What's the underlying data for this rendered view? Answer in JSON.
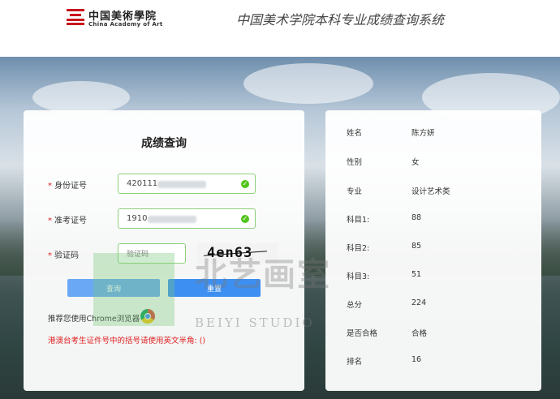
{
  "header": {
    "logo_cn": "中国美術學院",
    "logo_en": "China Academy of Art",
    "site_title": "中国美术学院本科专业成绩查询系统"
  },
  "form": {
    "title": "成绩查询",
    "fields": [
      {
        "label": "身份证号",
        "value": "420111"
      },
      {
        "label": "准考证号",
        "value": "1910"
      },
      {
        "label": "验证码",
        "value": ""
      }
    ],
    "captcha_placeholder": "验证码",
    "captcha_text": "4en63",
    "query_button": "查询",
    "reset_button": "重置",
    "browser_tip": "推荐您使用Chrome浏览器",
    "hk_tip": "港澳台考生证件号中的括号请使用英文半角: ()"
  },
  "result": {
    "rows": [
      {
        "key": "姓名",
        "value": "陈方妍"
      },
      {
        "key": "性别",
        "value": "女"
      },
      {
        "key": "专业",
        "value": "设计艺术类"
      },
      {
        "key": "科目1:",
        "value": "88"
      },
      {
        "key": "科目2:",
        "value": "85"
      },
      {
        "key": "科目3:",
        "value": "51"
      },
      {
        "key": "总分",
        "value": "224"
      },
      {
        "key": "是否合格",
        "value": "合格"
      },
      {
        "key": "排名",
        "value": "16"
      }
    ]
  },
  "watermark": {
    "text": "北艺画室",
    "sub": "BEIYI STUDIO"
  },
  "colors": {
    "brand_red": "#c8161d",
    "required_red": "#e02020",
    "button_blue": "#3d8ff2",
    "field_border_green": "#8ccf7a"
  }
}
